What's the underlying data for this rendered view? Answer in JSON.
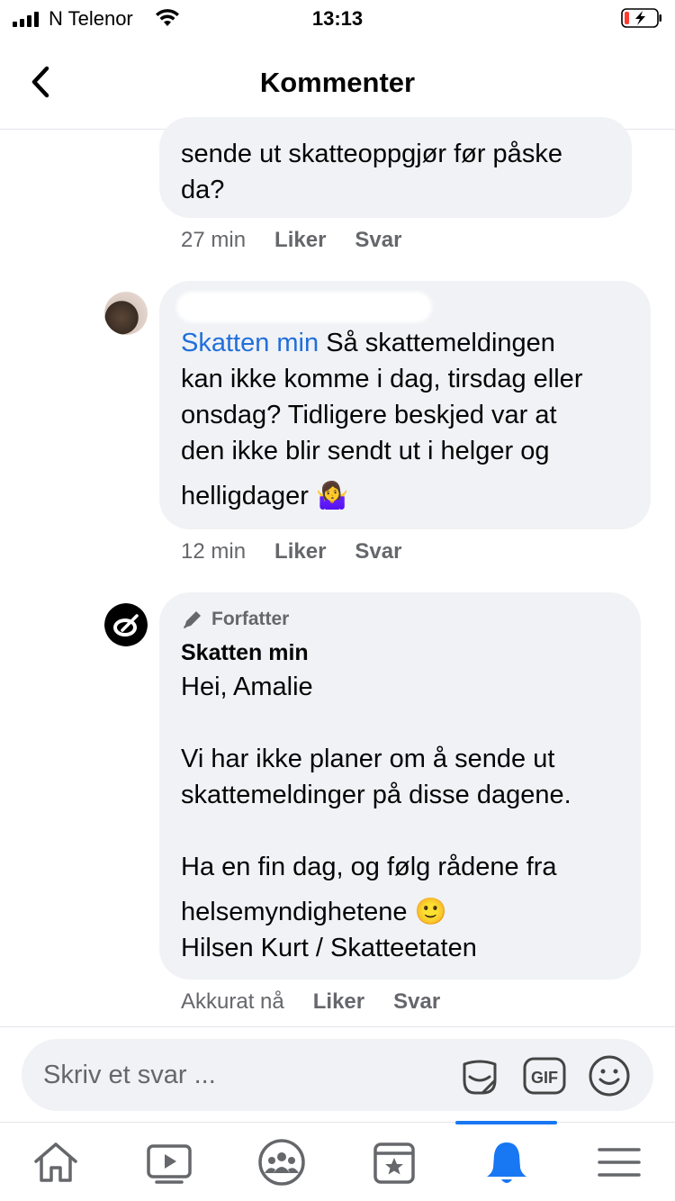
{
  "status_bar": {
    "carrier": "N Telenor",
    "time": "13:13"
  },
  "header": {
    "title": "Kommenter"
  },
  "comments": [
    {
      "text_lines": [
        "sende ut skatteoppgjør før påske",
        "da?"
      ],
      "timestamp": "27 min",
      "like_label": "Liker",
      "reply_label": "Svar"
    },
    {
      "mention": "Skatten min",
      "text_first_line_rest": " Så skattemeldingen",
      "text_lines": [
        "kan ikke komme i dag, tirsdag eller",
        "onsdag? Tidligere beskjed var at",
        "den ikke blir sendt ut i helger og",
        "helligdager"
      ],
      "emoji": "🤷‍♀️",
      "timestamp": "12 min",
      "like_label": "Liker",
      "reply_label": "Svar"
    },
    {
      "badge": "Forfatter",
      "author": "Skatten min",
      "text_lines": [
        "Hei, Amalie",
        "",
        "Vi har ikke planer om å sende ut",
        "skattemeldinger på disse dagene.",
        "",
        "Ha en fin dag, og følg rådene fra",
        "helsemyndighetene",
        "Hilsen Kurt / Skatteetaten"
      ],
      "emoji": "🙂",
      "timestamp": "Akkurat nå",
      "like_label": "Liker",
      "reply_label": "Svar"
    }
  ],
  "composer": {
    "placeholder": "Skriv et svar ..."
  },
  "tabs": [
    "home",
    "watch",
    "groups",
    "marketplace",
    "notifications",
    "menu"
  ],
  "colors": {
    "accent": "#1877f2",
    "mention": "#216fdb",
    "bubble": "#f0f2f5",
    "secondary_text": "#65676b",
    "battery_low": "#ff3b30"
  }
}
